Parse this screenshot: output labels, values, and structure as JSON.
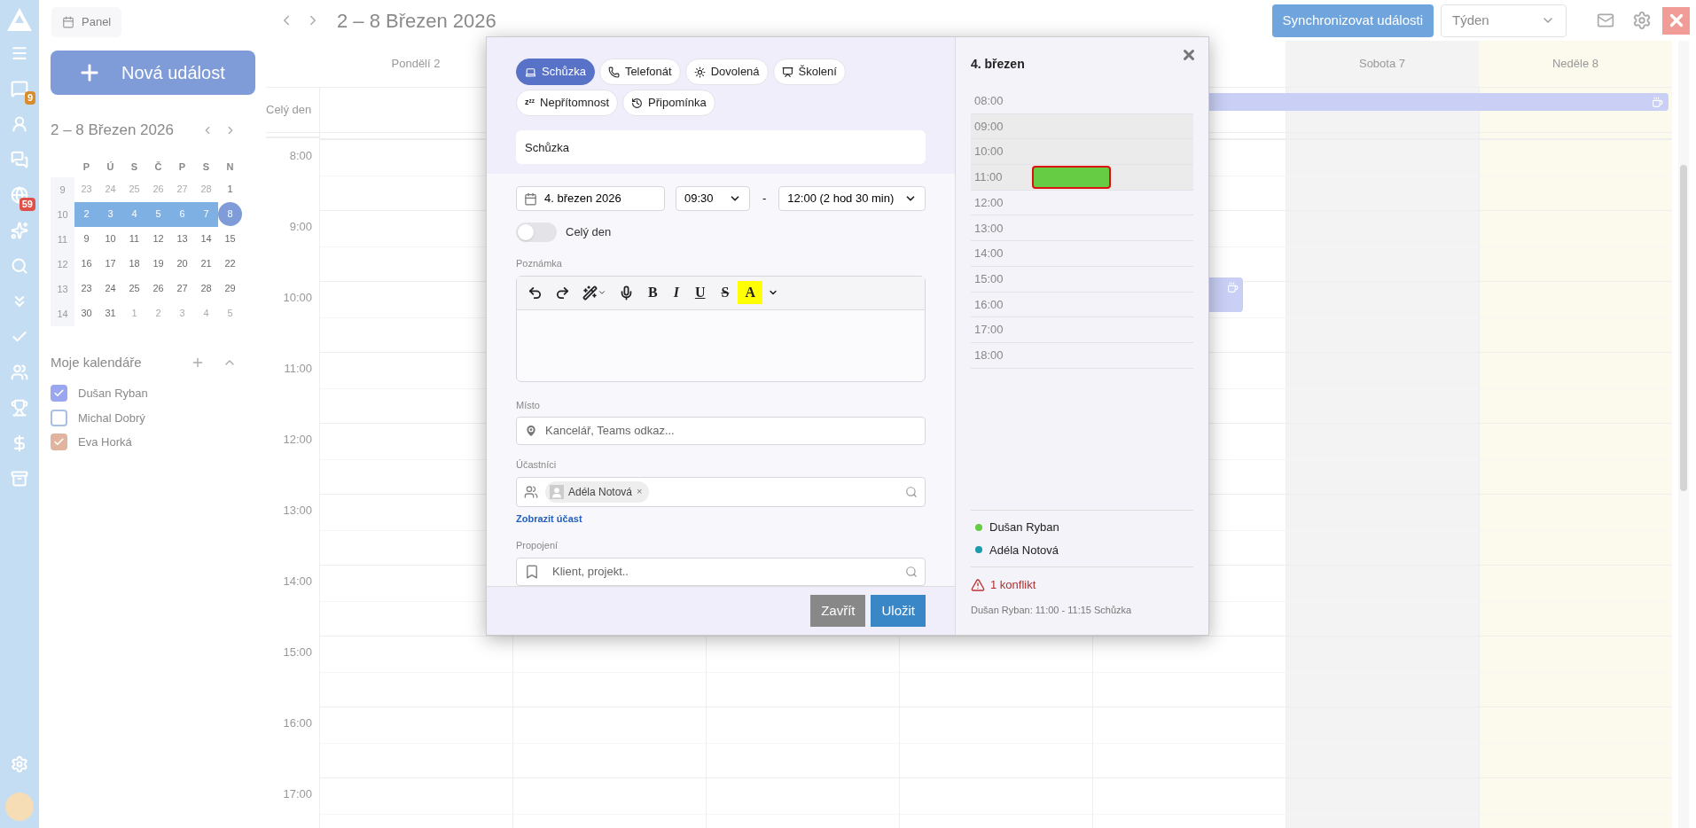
{
  "sidebar": {
    "nav_items": [
      {
        "kind": "logo"
      },
      {
        "kind": "menu"
      },
      {
        "kind": "tasks",
        "badge": "9",
        "color": "#d98c2b"
      },
      {
        "kind": "contacts"
      },
      {
        "kind": "chat"
      },
      {
        "kind": "globe",
        "badge": "59",
        "color": "#e0504a"
      },
      {
        "kind": "sparkles"
      },
      {
        "kind": "search"
      },
      {
        "kind": "more"
      },
      {
        "kind": "check"
      },
      {
        "kind": "team"
      },
      {
        "kind": "trophy"
      },
      {
        "kind": "money"
      },
      {
        "kind": "archive"
      }
    ],
    "bottom_items": [
      {
        "kind": "settings"
      },
      {
        "kind": "avatar"
      }
    ]
  },
  "left_panel": {
    "panel_button": "Panel",
    "new_event_button": "Nová událost",
    "mini_calendar": {
      "title": "2 – 8 Březen 2026",
      "weekdays": [
        "P",
        "Ú",
        "S",
        "Č",
        "P",
        "S",
        "N"
      ],
      "weeks": [
        {
          "number": "9",
          "selected": false,
          "days": [
            {
              "label": "23",
              "outside": true,
              "today": false
            },
            {
              "label": "24",
              "outside": true,
              "today": false
            },
            {
              "label": "25",
              "outside": true,
              "today": false
            },
            {
              "label": "26",
              "outside": true,
              "today": false
            },
            {
              "label": "27",
              "outside": true,
              "today": false
            },
            {
              "label": "28",
              "outside": true,
              "today": false
            },
            {
              "label": "1",
              "outside": false,
              "today": false
            }
          ]
        },
        {
          "number": "10",
          "selected": true,
          "days": [
            {
              "label": "2",
              "outside": false,
              "today": false
            },
            {
              "label": "3",
              "outside": false,
              "today": false
            },
            {
              "label": "4",
              "outside": false,
              "today": false
            },
            {
              "label": "5",
              "outside": false,
              "today": false
            },
            {
              "label": "6",
              "outside": false,
              "today": false
            },
            {
              "label": "7",
              "outside": false,
              "today": false
            },
            {
              "label": "8",
              "outside": false,
              "today": true
            }
          ]
        },
        {
          "number": "11",
          "selected": false,
          "days": [
            {
              "label": "9",
              "outside": false,
              "today": false
            },
            {
              "label": "10",
              "outside": false,
              "today": false
            },
            {
              "label": "11",
              "outside": false,
              "today": false
            },
            {
              "label": "12",
              "outside": false,
              "today": false
            },
            {
              "label": "13",
              "outside": false,
              "today": false
            },
            {
              "label": "14",
              "outside": false,
              "today": false
            },
            {
              "label": "15",
              "outside": false,
              "today": false
            }
          ]
        },
        {
          "number": "12",
          "selected": false,
          "days": [
            {
              "label": "16",
              "outside": false,
              "today": false
            },
            {
              "label": "17",
              "outside": false,
              "today": false
            },
            {
              "label": "18",
              "outside": false,
              "today": false
            },
            {
              "label": "19",
              "outside": false,
              "today": false
            },
            {
              "label": "20",
              "outside": false,
              "today": false
            },
            {
              "label": "21",
              "outside": false,
              "today": false
            },
            {
              "label": "22",
              "outside": false,
              "today": false
            }
          ]
        },
        {
          "number": "13",
          "selected": false,
          "days": [
            {
              "label": "23",
              "outside": false,
              "today": false
            },
            {
              "label": "24",
              "outside": false,
              "today": false
            },
            {
              "label": "25",
              "outside": false,
              "today": false
            },
            {
              "label": "26",
              "outside": false,
              "today": false
            },
            {
              "label": "27",
              "outside": false,
              "today": false
            },
            {
              "label": "28",
              "outside": false,
              "today": false
            },
            {
              "label": "29",
              "outside": false,
              "today": false
            }
          ]
        },
        {
          "number": "14",
          "selected": false,
          "days": [
            {
              "label": "30",
              "outside": false,
              "today": false
            },
            {
              "label": "31",
              "outside": false,
              "today": false
            },
            {
              "label": "1",
              "outside": true,
              "today": false
            },
            {
              "label": "2",
              "outside": true,
              "today": false
            },
            {
              "label": "3",
              "outside": true,
              "today": false
            },
            {
              "label": "4",
              "outside": true,
              "today": false
            },
            {
              "label": "5",
              "outside": true,
              "today": false
            }
          ]
        }
      ]
    },
    "my_calendars": {
      "title": "Moje kalendáře",
      "items": [
        {
          "name": "Dušan Ryban",
          "checked": true,
          "color": "#9aa6f0"
        },
        {
          "name": "Michal Dobrý",
          "checked": false,
          "color": "#a9c0e4"
        },
        {
          "name": "Eva Horká",
          "checked": true,
          "color": "#e0b49e"
        }
      ]
    }
  },
  "header": {
    "title": "2 – 8 Březen 2026",
    "sync_button": "Synchronizovat události",
    "view_select": "Týden"
  },
  "calendar": {
    "columns": [
      {
        "label": "Pondělí 2",
        "kind": "weekday",
        "all_day_event": false,
        "timed_event": false
      },
      {
        "kind": "weekday",
        "all_day_event": false,
        "timed_event": false
      },
      {
        "kind": "weekday",
        "all_day_event": false,
        "timed_event": false
      },
      {
        "kind": "weekday",
        "all_day_event": false,
        "timed_event": false
      },
      {
        "kind": "weekday",
        "all_day_event": true,
        "timed_event": true
      },
      {
        "label": "Sobota 7",
        "kind": "weekend",
        "all_day_event": true,
        "timed_event": false
      },
      {
        "label": "Neděle 8",
        "kind": "today",
        "all_day_event": true,
        "timed_event": false
      }
    ],
    "all_day_label": "Celý den",
    "hours": [
      "8:00",
      "9:00",
      "10:00",
      "11:00",
      "12:00",
      "13:00",
      "14:00",
      "15:00",
      "16:00",
      "17:00"
    ]
  },
  "modal": {
    "event_types": [
      {
        "kind": "meeting",
        "label": "Schůzka",
        "selected": true
      },
      {
        "kind": "call",
        "label": "Telefonát",
        "selected": false
      },
      {
        "kind": "vacation",
        "label": "Dovolená",
        "selected": false
      },
      {
        "kind": "training",
        "label": "Školení",
        "selected": false
      },
      {
        "kind": "absence",
        "label": "Nepřítomnost",
        "glyph": "zᶻᶻ",
        "selected": false
      },
      {
        "kind": "reminder",
        "label": "Připomínka",
        "selected": false
      }
    ],
    "title_value": "Schůzka",
    "date": "4. březen 2026",
    "start_time": "09:30",
    "separator": "-",
    "end_time": "12:00 (2 hod 30 min)",
    "all_day": {
      "label": "Celý den",
      "on": false
    },
    "note": {
      "label": "Poznámka",
      "toolbar": [
        {
          "kind": "undo"
        },
        {
          "kind": "redo"
        },
        {
          "kind": "magic"
        },
        {
          "kind": "mic"
        },
        {
          "kind": "bold",
          "text": "B"
        },
        {
          "kind": "italic",
          "text": "I"
        },
        {
          "kind": "underline",
          "text": "U"
        },
        {
          "kind": "strike",
          "text": "S"
        },
        {
          "kind": "highlight",
          "text": "A"
        },
        {
          "kind": "caret"
        }
      ]
    },
    "place": {
      "label": "Místo",
      "placeholder": "Kancelář, Teams odkaz..."
    },
    "participants": {
      "label": "Účastníci",
      "chips": [
        {
          "name": "Adéla Notová",
          "remove": "×"
        }
      ],
      "link": "Zobrazit účast"
    },
    "connection": {
      "label": "Propojení",
      "placeholder": "Klient, projekt.."
    },
    "buttons": [
      {
        "kind": "close",
        "label": "Zavřít"
      },
      {
        "kind": "save",
        "label": "Uložit"
      }
    ],
    "side": {
      "date": "4. březen",
      "timeline": [
        {
          "label": "08:00",
          "in_range": false
        },
        {
          "label": "09:00",
          "in_range": true
        },
        {
          "label": "10:00",
          "in_range": true
        },
        {
          "label": "11:00",
          "in_range": true,
          "busy": {
            "color": "#66cc44",
            "conflict": true
          }
        },
        {
          "label": "12:00",
          "in_range": false
        },
        {
          "label": "13:00",
          "in_range": false
        },
        {
          "label": "14:00",
          "in_range": false
        },
        {
          "label": "15:00",
          "in_range": false
        },
        {
          "label": "16:00",
          "in_range": false
        },
        {
          "label": "17:00",
          "in_range": false
        },
        {
          "label": "18:00",
          "in_range": false
        }
      ],
      "legend": [
        {
          "name": "Dušan Ryban",
          "color": "#66cc44"
        },
        {
          "name": "Adéla Notová",
          "color": "#1a9aaa"
        }
      ],
      "conflict": {
        "title": "1 konflikt",
        "detail": "Dušan Ryban: 11:00 - 11:15 Schůzka"
      }
    }
  }
}
